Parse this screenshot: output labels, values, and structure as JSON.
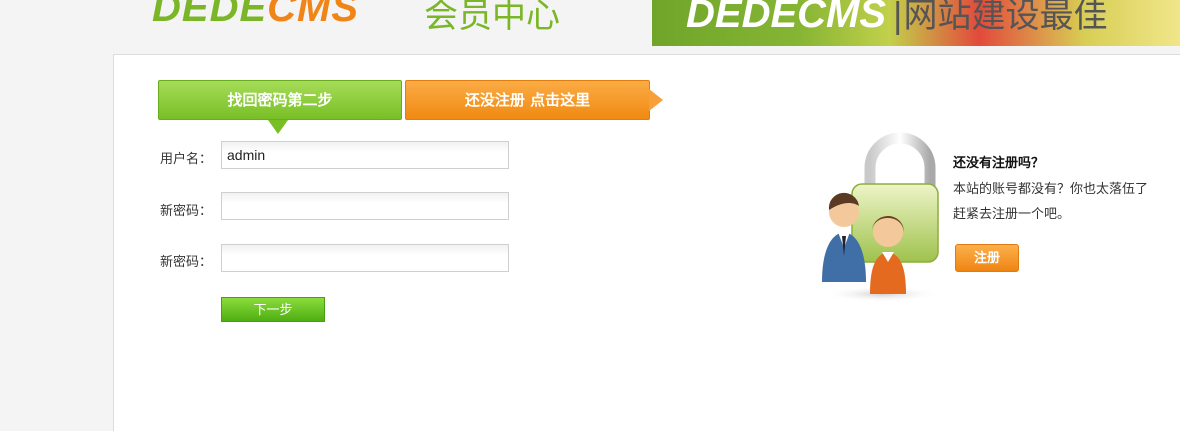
{
  "header": {
    "logo_main": "DEDE",
    "logo_accent": "CMS",
    "logo_sub": "会员中心",
    "banner_main": "DEDECMS",
    "banner_sub": "|网站建设最佳"
  },
  "tabs": {
    "current": "找回密码第二步",
    "register": "还没注册 点击这里"
  },
  "form": {
    "username_label": "用户名：",
    "username_value": "admin",
    "new_password_label": "新密码：",
    "confirm_password_label": "新密码：",
    "next_button": "下一步"
  },
  "side": {
    "title": "还没有注册吗？",
    "text1": "本站的账号都没有？你也太落伍了",
    "text2": "赶紧去注册一个吧。",
    "register_button": "注册"
  }
}
